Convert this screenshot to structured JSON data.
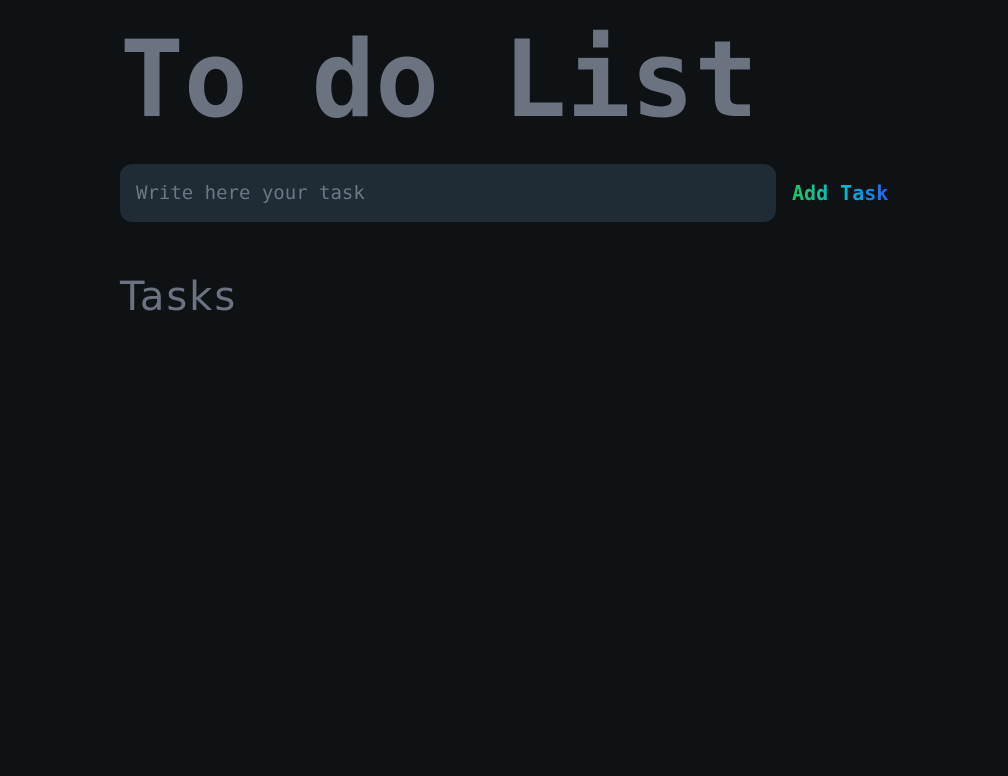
{
  "header": {
    "title": "To do List"
  },
  "task_form": {
    "input_value": "",
    "input_placeholder": "Write here your task",
    "add_button_label": "Add Task"
  },
  "tasks_section": {
    "heading": "Tasks",
    "items": []
  },
  "colors": {
    "background": "#0e1214",
    "title": "#6b7280",
    "input_background": "#1f2b35",
    "button_gradient_start": "#22c55e",
    "button_gradient_mid": "#06b6d4",
    "button_gradient_end": "#2563eb"
  }
}
